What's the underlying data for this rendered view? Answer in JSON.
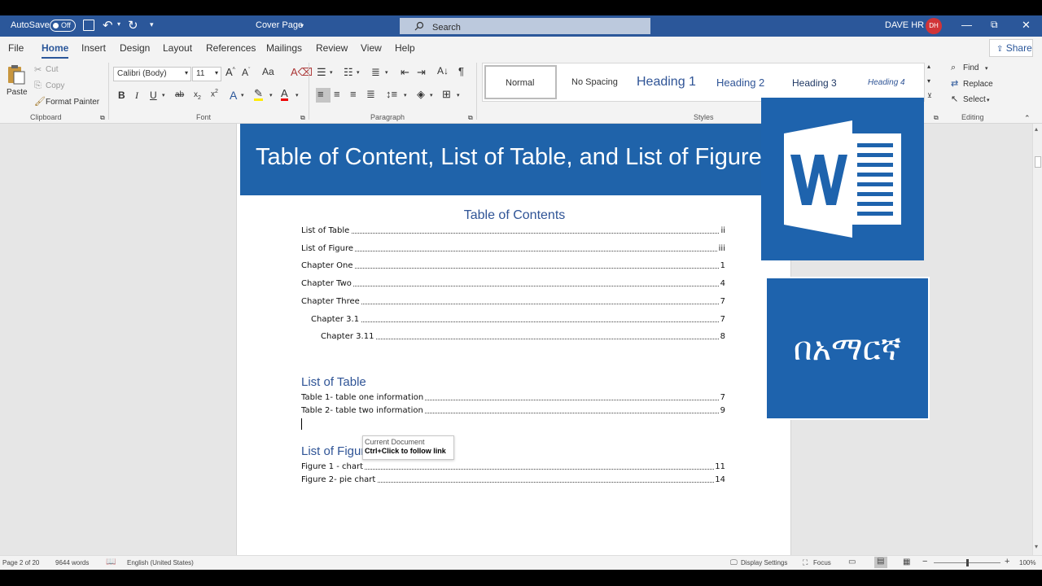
{
  "titlebar": {
    "autosave": "AutoSave",
    "toggle": "Off",
    "doc_title": "Cover Page",
    "search_placeholder": "Search",
    "user": "DAVE HR",
    "avatar": "DH"
  },
  "menu": {
    "tabs": [
      "File",
      "Home",
      "Insert",
      "Design",
      "Layout",
      "References",
      "Mailings",
      "Review",
      "View",
      "Help"
    ],
    "share": "Share"
  },
  "ribbon": {
    "clipboard": {
      "paste": "Paste",
      "cut": "Cut",
      "copy": "Copy",
      "format_painter": "Format Painter",
      "group": "Clipboard"
    },
    "font": {
      "family": "Calibri (Body)",
      "size": "11",
      "group": "Font"
    },
    "paragraph": {
      "group": "Paragraph"
    },
    "styles": {
      "items": [
        "Normal",
        "No Spacing",
        "Heading 1",
        "Heading 2",
        "Heading 3",
        "Heading 4"
      ],
      "group": "Styles"
    },
    "editing": {
      "find": "Find",
      "replace": "Replace",
      "select": "Select",
      "group": "Editing"
    }
  },
  "document": {
    "banner": "Table of Content, List of Table, and List of Figure",
    "toc_title": "Table of Contents",
    "toc": [
      {
        "label": "List of Table",
        "page": "ii"
      },
      {
        "label": "List of Figure",
        "page": "iii"
      },
      {
        "label": "Chapter One",
        "page": "1"
      },
      {
        "label": "Chapter Two",
        "page": "4"
      },
      {
        "label": "Chapter Three",
        "page": "7"
      },
      {
        "label": "Chapter 3.1",
        "page": "7"
      },
      {
        "label": "Chapter 3.11",
        "page": "8"
      }
    ],
    "lot_title": "List of Table",
    "lot": [
      {
        "label": "Table 1- table one information",
        "page": "7"
      },
      {
        "label": "Table 2- table two information",
        "page": "9"
      }
    ],
    "lof_title": "List of Figure",
    "lof": [
      {
        "label": "Figure 1 - chart",
        "page": "11"
      },
      {
        "label": "Figure 2- pie chart",
        "page": "14"
      }
    ],
    "tooltip": {
      "line1": "Current Document",
      "line2": "Ctrl+Click to follow link"
    }
  },
  "overlay": {
    "amharic": "በአማርኛ"
  },
  "status": {
    "page": "Page 2 of 20",
    "words": "9644 words",
    "language": "English (United States)",
    "display": "Display Settings",
    "focus": "Focus",
    "zoom": "100%"
  }
}
